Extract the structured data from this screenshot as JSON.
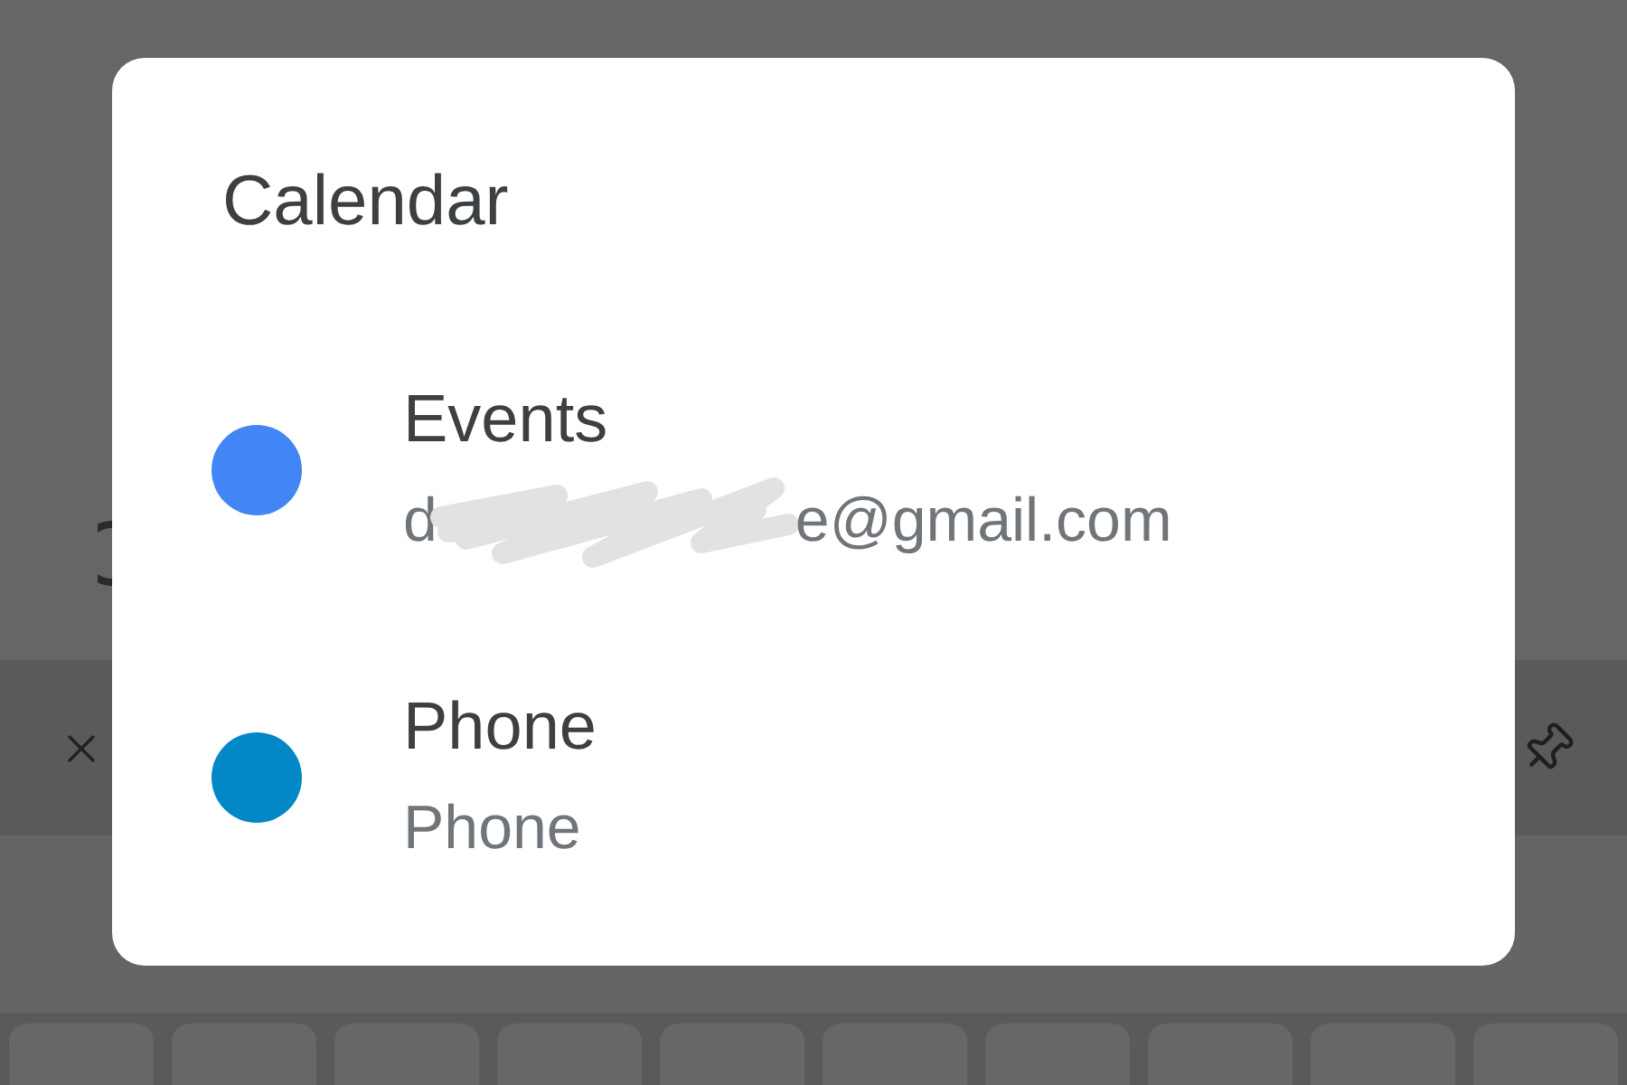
{
  "dialog": {
    "title": "Calendar",
    "calendars": [
      {
        "name": "Events",
        "subtitle": "d",
        "redacted": true,
        "subtitle_after": "e@gmail.com",
        "color": "#4285f4"
      },
      {
        "name": "Phone",
        "subtitle": "Phone",
        "redacted": false,
        "color": "#0288c6"
      }
    ]
  }
}
